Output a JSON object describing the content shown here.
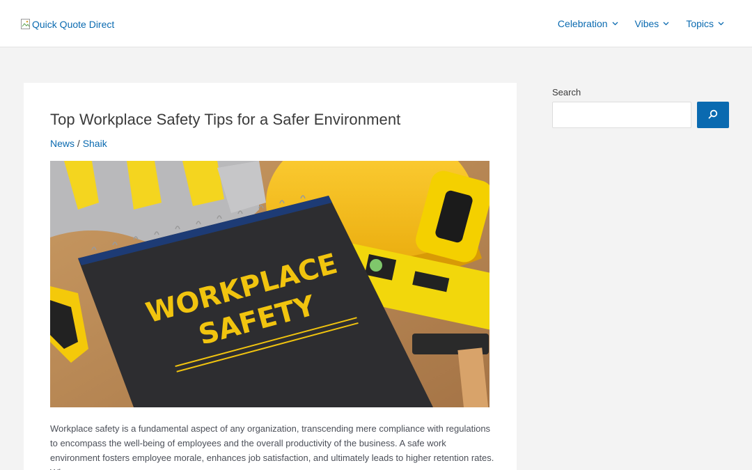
{
  "header": {
    "logo_alt": "Quick Quote Direct",
    "nav": [
      {
        "label": "Celebration"
      },
      {
        "label": "Vibes"
      },
      {
        "label": "Topics"
      }
    ]
  },
  "article": {
    "title": "Top Workplace Safety Tips for a Safer Environment",
    "category": "News",
    "separator": " / ",
    "author": "Shaik",
    "hero_text_line1": "WORKPLACE",
    "hero_text_line2": "SAFETY",
    "body": "Workplace safety is a fundamental aspect of any organization, transcending mere compliance with regulations to encompass the well-being of employees and the overall productivity of the business. A safe work environment fosters employee morale, enhances job satisfaction, and ultimately leads to higher retention rates. When"
  },
  "sidebar": {
    "search_label": "Search",
    "search_value": ""
  },
  "colors": {
    "accent": "#0a6ab0",
    "background": "#f3f3f3",
    "text": "#3a3a3a"
  },
  "icons": {
    "broken_image": "broken-image-icon",
    "chevron": "chevron-down-icon",
    "search": "search-icon"
  }
}
